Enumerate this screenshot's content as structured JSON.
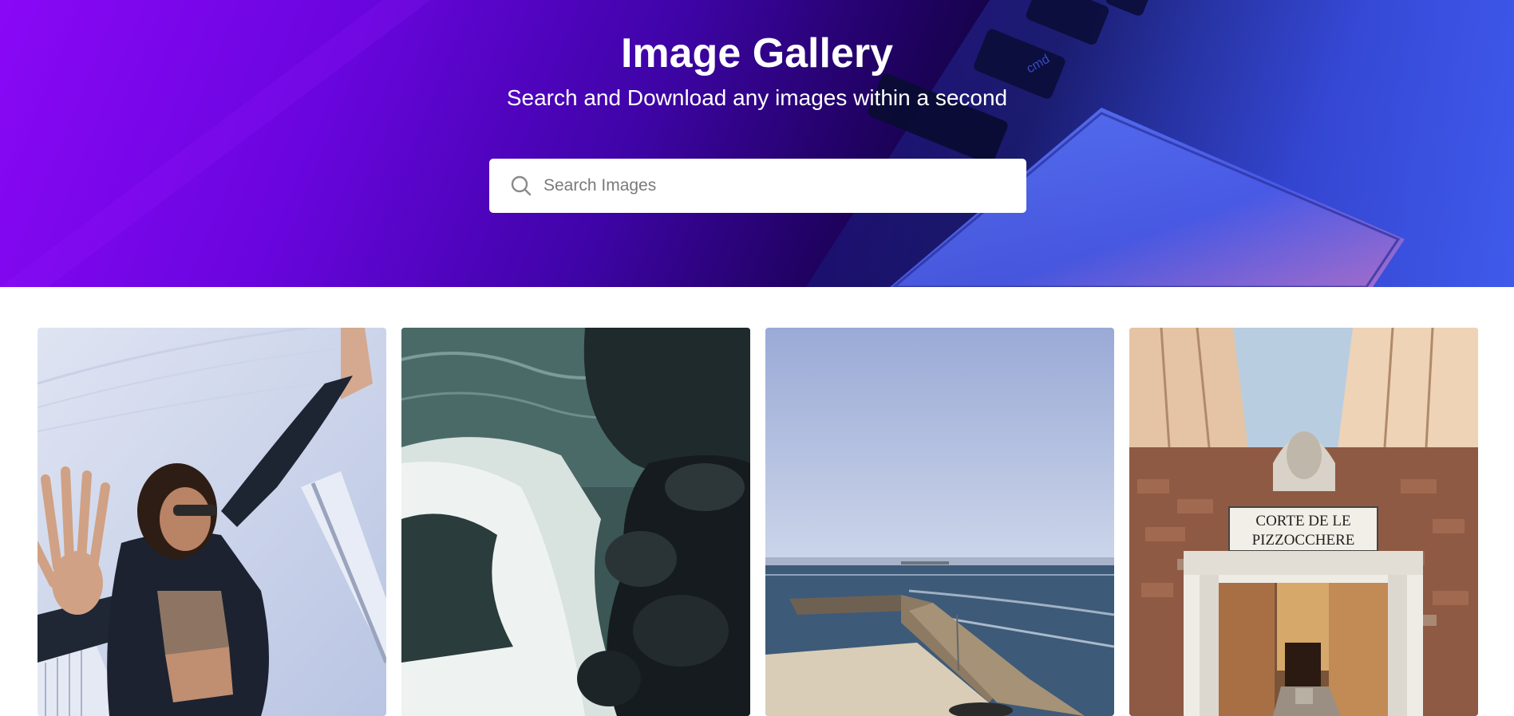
{
  "header": {
    "title": "Image Gallery",
    "subtitle": "Search and Download any images within a second"
  },
  "search": {
    "placeholder": "Search Images",
    "value": "",
    "icon": "search-icon"
  },
  "laptop_keys": [
    "cmd"
  ],
  "gallery": {
    "images": [
      {
        "subject": "woman-in-leather-jacket"
      },
      {
        "subject": "ocean-waves-on-rocks"
      },
      {
        "subject": "sea-pier-with-rocks"
      },
      {
        "subject": "venice-alley-gate"
      }
    ],
    "sign_line1": "CORTE DE LE",
    "sign_line2": "PIZZOCCHERE"
  },
  "colors": {
    "hero_gradient_start": "#8a08f6",
    "hero_gradient_mid": "#1c0259",
    "hero_gradient_end": "#4060f0",
    "title_text": "#ffffff",
    "search_background": "#ffffff",
    "page_background": "#ffffff"
  }
}
